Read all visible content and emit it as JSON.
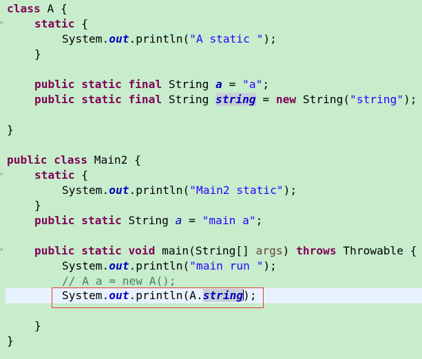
{
  "editor": {
    "lines": [
      [
        "class",
        " A {"
      ],
      [
        "static",
        " {"
      ],
      [
        "System.",
        "out",
        ".println(",
        "\"A static \"",
        ");"
      ],
      [
        "}"
      ],
      [
        "public static final",
        " String ",
        "a",
        " = ",
        "\"a\"",
        ";"
      ],
      [
        "public static final",
        " String ",
        "string",
        " = ",
        "new",
        " String(",
        "\"string\"",
        ");"
      ],
      [
        "}"
      ],
      [
        "public class",
        " Main2 {"
      ],
      [
        "static",
        " {"
      ],
      [
        "System.",
        "out",
        ".println(",
        "\"Main2 static\"",
        ");"
      ],
      [
        "}"
      ],
      [
        "public static",
        " String ",
        "a",
        " = ",
        "\"main a\"",
        ";"
      ],
      [
        "public static void",
        " main(String[] ",
        "args",
        ") ",
        "throws",
        " Throwable {"
      ],
      [
        "System.",
        "out",
        ".println(",
        "\"main run \"",
        ");"
      ],
      [
        "// A a = new A();"
      ],
      [
        "System.",
        "out",
        ".println(A.",
        "string",
        ");"
      ],
      [
        "}"
      ],
      [
        "}"
      ]
    ]
  }
}
